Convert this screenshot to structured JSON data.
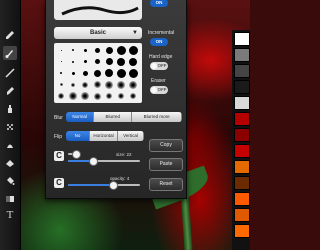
{
  "panel": {
    "top_toggle": "ON",
    "preset": "Basic",
    "incremental_label": "Incremental",
    "incremental_toggle": "ON",
    "hard_edge_label": "Hard edge",
    "hard_edge_toggle": "OFF",
    "eraser_label": "Eraser",
    "eraser_toggle": "OFF",
    "blur_label": "Blur",
    "blur_options": [
      "Normal",
      "Blurred",
      "Blurred more"
    ],
    "blur_selected": 0,
    "flip_label": "Flip",
    "flip_options": [
      "No",
      "Horizontal",
      "Vertical"
    ],
    "flip_selected": 0,
    "size_label": "size: 22",
    "opacity_label": "opacity: 4",
    "size_fraction": 0.35,
    "opacity_fraction": 0.62,
    "copy": "Copy",
    "paste": "Paste",
    "reset": "Reset"
  },
  "palette_colors": [
    "#ffffff",
    "#7a7a7a",
    "#444444",
    "#1a1a1a",
    "#d8d8d8",
    "#b50000",
    "#8a0000",
    "#c40000",
    "#e26a00",
    "#6b2a00",
    "#ff5a00",
    "#e05800",
    "#ff6a00"
  ]
}
